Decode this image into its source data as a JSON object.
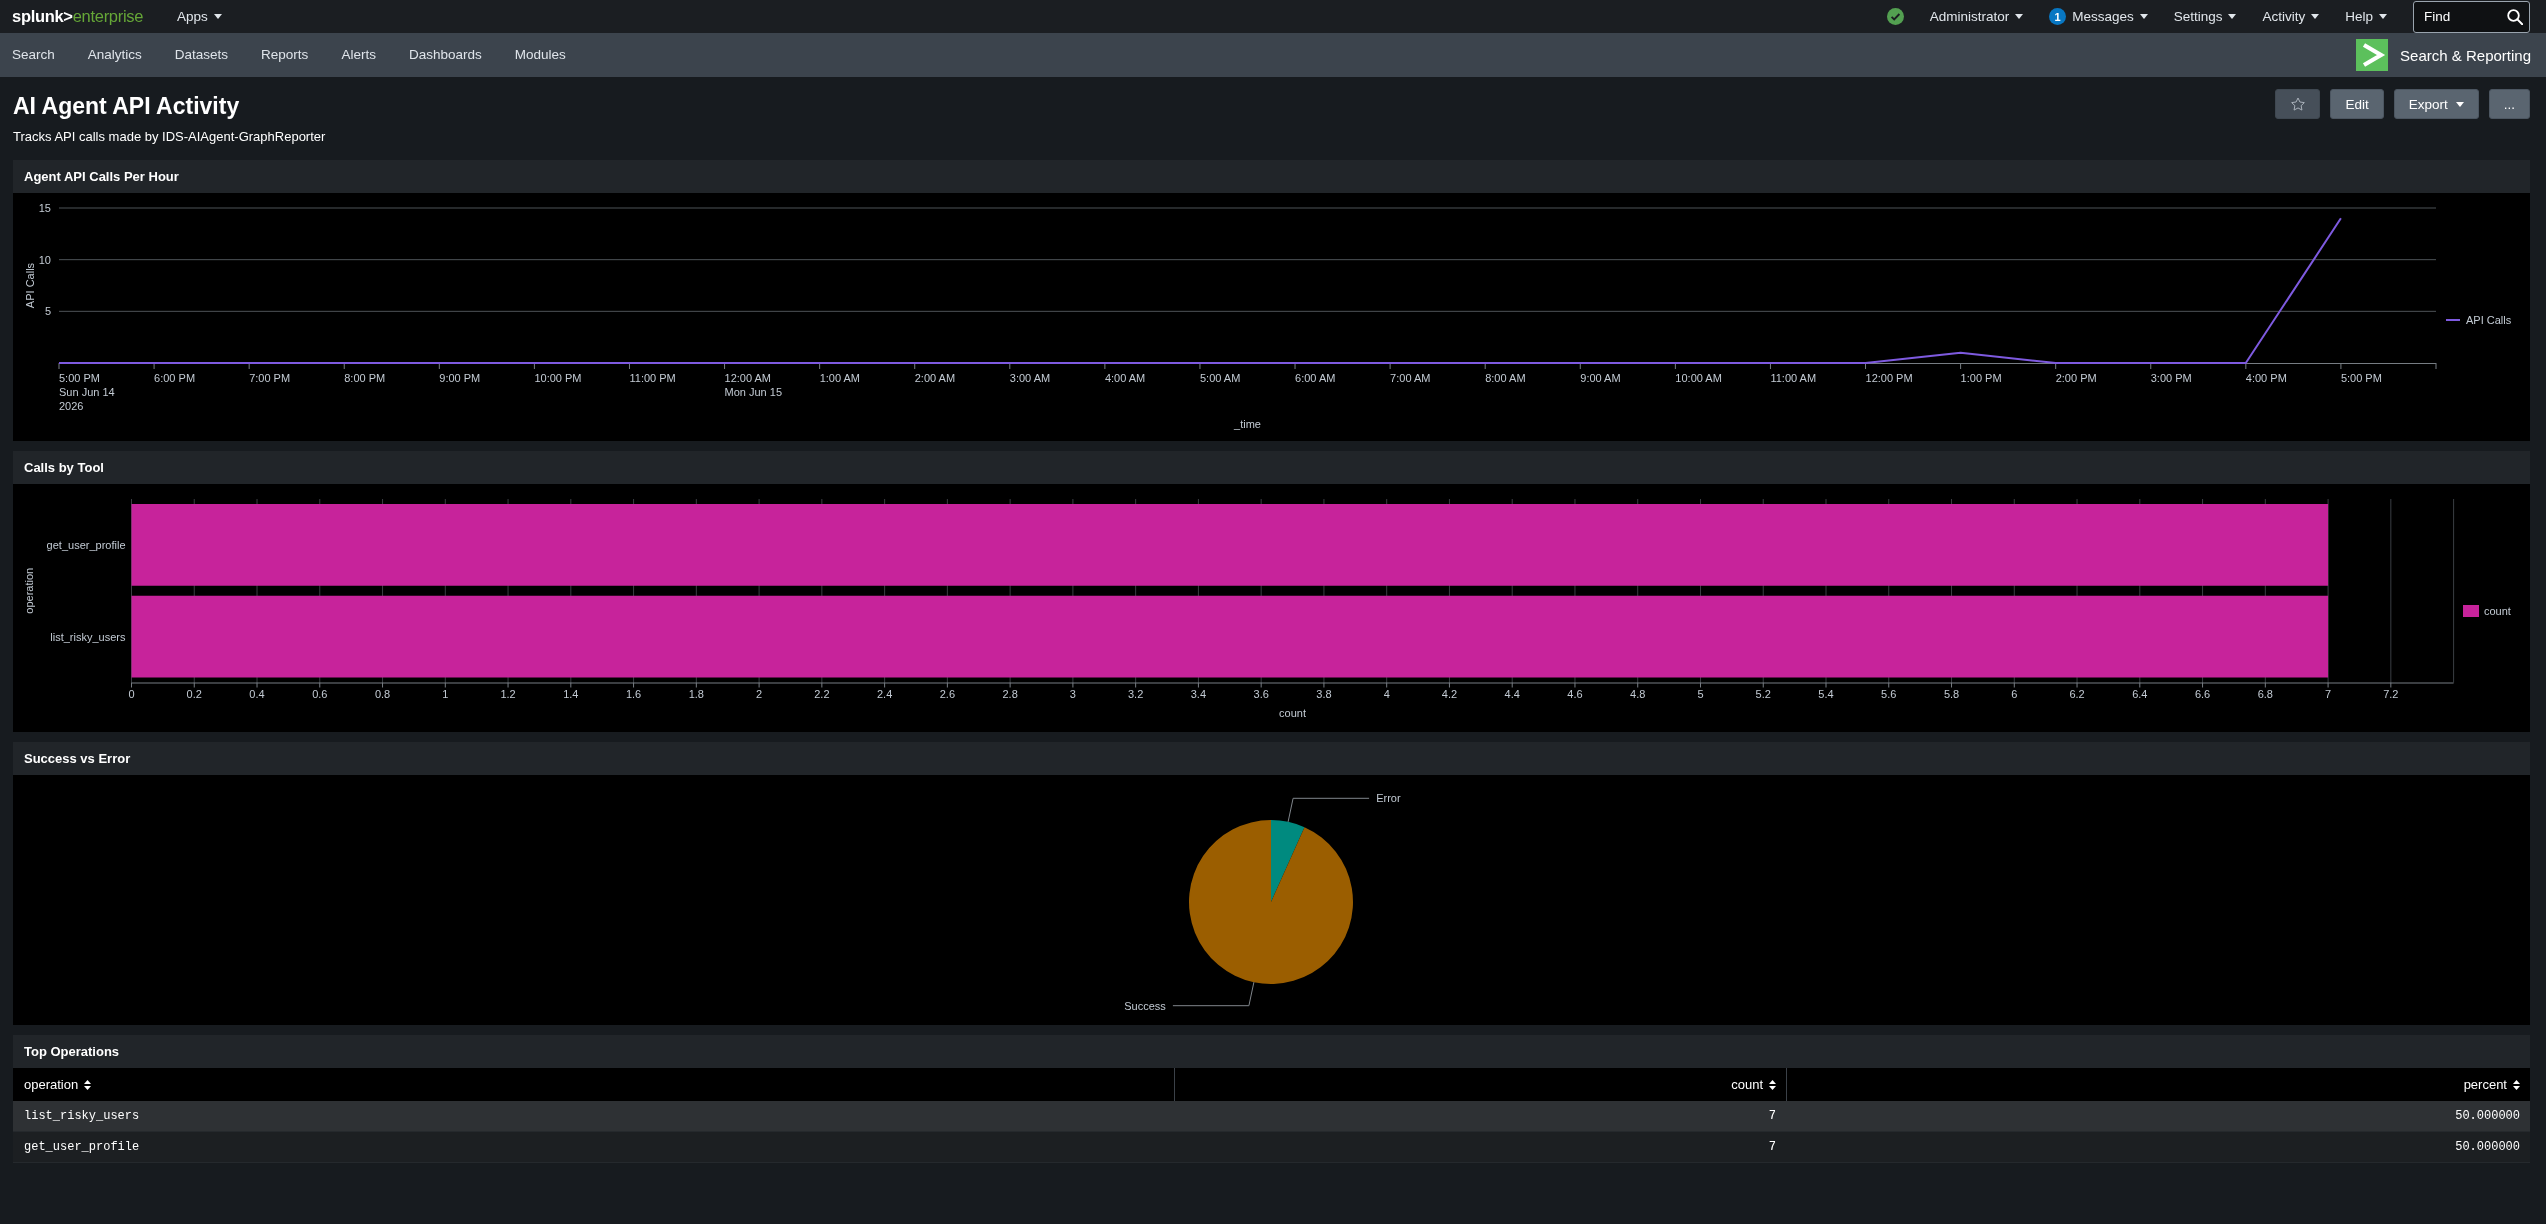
{
  "top_bar": {
    "logo": {
      "brand": "splunk>",
      "product": "enterprise"
    },
    "apps_menu": {
      "label": "Apps"
    },
    "user_menus": [
      {
        "label": "Administrator"
      },
      {
        "label": "Messages",
        "badge": "1"
      },
      {
        "label": "Settings"
      },
      {
        "label": "Activity"
      },
      {
        "label": "Help"
      }
    ],
    "search": {
      "placeholder": "Find"
    }
  },
  "nav": {
    "items": [
      {
        "label": "Search",
        "selected": false
      },
      {
        "label": "Analytics",
        "selected": false
      },
      {
        "label": "Datasets",
        "selected": false
      },
      {
        "label": "Reports",
        "selected": false
      },
      {
        "label": "Alerts",
        "selected": false
      },
      {
        "label": "Dashboards",
        "selected": false
      },
      {
        "label": "Modules",
        "selected": false
      }
    ],
    "app": {
      "label": "Search & Reporting"
    }
  },
  "dashboard": {
    "title": "AI Agent API Activity",
    "description": "Tracks API calls made by IDS-AIAgent-GraphReporter",
    "actions": [
      {
        "kind": "favorite",
        "starred": false
      },
      {
        "kind": "button",
        "label": "Edit"
      },
      {
        "kind": "dropdown",
        "label": "Export"
      },
      {
        "kind": "button",
        "label": "..."
      }
    ]
  },
  "panels": [
    {
      "title": "Agent API Calls Per Hour",
      "chart_data": {
        "type": "line",
        "xlabel": "_time",
        "ylabel": "API Calls",
        "categories": [
          "5:00 PM\nSun Jun 14\n2026",
          "6:00 PM",
          "7:00 PM",
          "8:00 PM",
          "9:00 PM",
          "10:00 PM",
          "11:00 PM",
          "12:00 AM\nMon Jun 15",
          "1:00 AM",
          "2:00 AM",
          "3:00 AM",
          "4:00 AM",
          "5:00 AM",
          "6:00 AM",
          "7:00 AM",
          "8:00 AM",
          "9:00 AM",
          "10:00 AM",
          "11:00 AM",
          "12:00 PM",
          "1:00 PM",
          "2:00 PM",
          "3:00 PM",
          "4:00 PM",
          "5:00 PM"
        ],
        "series": [
          {
            "name": "API Calls",
            "color": "#7e5ae0",
            "values": [
              0,
              0,
              0,
              0,
              0,
              0,
              0,
              0,
              0,
              0,
              0,
              0,
              0,
              0,
              0,
              0,
              0,
              0,
              0,
              0,
              1,
              0,
              0,
              0,
              14
            ]
          }
        ],
        "ylim": [
          0,
          15
        ],
        "yticks": [
          5,
          10,
          15
        ],
        "grid": true
      }
    },
    {
      "title": "Calls by Tool",
      "chart_data": {
        "type": "bar",
        "orientation": "horizontal",
        "xlabel": "count",
        "ylabel": "operation",
        "categories": [
          "get_user_profile",
          "list_risky_users"
        ],
        "series": [
          {
            "name": "count",
            "color": "#c7239b",
            "values": [
              7,
              7
            ]
          }
        ],
        "xlim": [
          0,
          7.4
        ],
        "xticks": [
          0,
          0.2,
          0.4,
          0.6,
          0.8,
          1,
          1.2,
          1.4,
          1.6,
          1.8,
          2,
          2.2,
          2.4,
          2.6,
          2.8,
          3,
          3.2,
          3.4,
          3.6,
          3.8,
          4,
          4.2,
          4.4,
          4.6,
          4.8,
          5,
          5.2,
          5.4,
          5.6,
          5.8,
          6,
          6.2,
          6.4,
          6.6,
          6.8,
          7,
          7.2
        ],
        "grid": true
      }
    },
    {
      "title": "Success vs Error",
      "chart_data": {
        "type": "pie",
        "categories": [
          "Error",
          "Success"
        ],
        "values": [
          6.7,
          93.3
        ],
        "colors": [
          "#008a7f",
          "#9b5e00"
        ]
      }
    },
    {
      "title": "Top Operations",
      "table": {
        "columns": [
          {
            "label": "operation",
            "kind": "text"
          },
          {
            "label": "count",
            "kind": "number"
          },
          {
            "label": "percent",
            "kind": "number"
          }
        ],
        "rows": [
          [
            "list_risky_users",
            "7",
            "50.000000"
          ],
          [
            "get_user_profile",
            "7",
            "50.000000"
          ]
        ]
      }
    }
  ]
}
